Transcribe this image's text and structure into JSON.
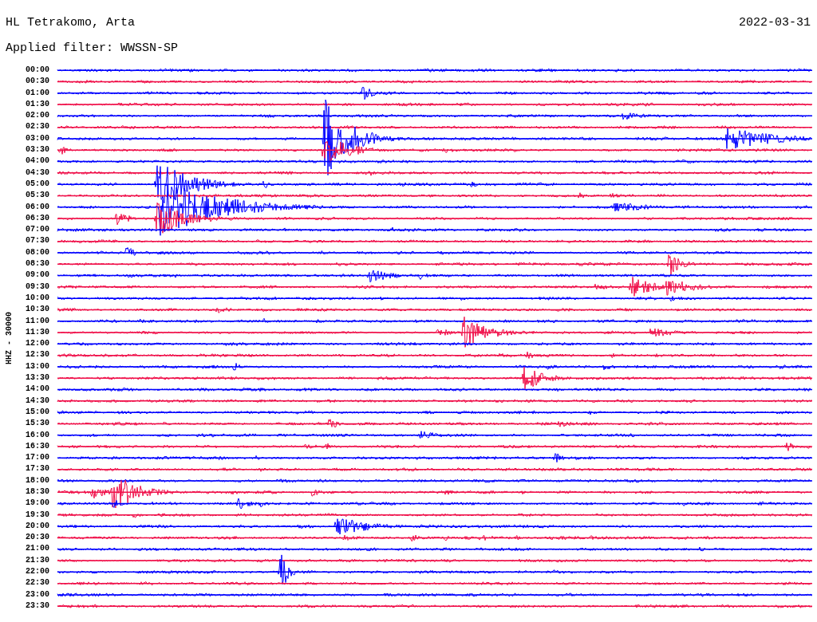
{
  "header": {
    "station": "HL Tetrakomo, Arta",
    "date": "2022-03-31",
    "filter": "Applied filter: WWSSN-SP"
  },
  "channel_label": "HHZ - 30000",
  "traces": [
    {
      "label": "00:00",
      "color": "#0000ff"
    },
    {
      "label": "00:30",
      "color": "#f0104a"
    },
    {
      "label": "01:00",
      "color": "#0000ff"
    },
    {
      "label": "01:30",
      "color": "#f0104a"
    },
    {
      "label": "02:00",
      "color": "#0000ff"
    },
    {
      "label": "02:30",
      "color": "#f0104a"
    },
    {
      "label": "03:00",
      "color": "#0000ff"
    },
    {
      "label": "03:30",
      "color": "#f0104a"
    },
    {
      "label": "04:00",
      "color": "#0000ff"
    },
    {
      "label": "04:30",
      "color": "#f0104a"
    },
    {
      "label": "05:00",
      "color": "#0000ff"
    },
    {
      "label": "05:30",
      "color": "#f0104a"
    },
    {
      "label": "06:00",
      "color": "#0000ff"
    },
    {
      "label": "06:30",
      "color": "#f0104a"
    },
    {
      "label": "07:00",
      "color": "#0000ff"
    },
    {
      "label": "07:30",
      "color": "#f0104a"
    },
    {
      "label": "08:00",
      "color": "#0000ff"
    },
    {
      "label": "08:30",
      "color": "#f0104a"
    },
    {
      "label": "09:00",
      "color": "#0000ff"
    },
    {
      "label": "09:30",
      "color": "#f0104a"
    },
    {
      "label": "10:00",
      "color": "#0000ff"
    },
    {
      "label": "10:30",
      "color": "#f0104a"
    },
    {
      "label": "11:00",
      "color": "#0000ff"
    },
    {
      "label": "11:30",
      "color": "#f0104a"
    },
    {
      "label": "12:00",
      "color": "#0000ff"
    },
    {
      "label": "12:30",
      "color": "#f0104a"
    },
    {
      "label": "13:00",
      "color": "#0000ff"
    },
    {
      "label": "13:30",
      "color": "#f0104a"
    },
    {
      "label": "14:00",
      "color": "#0000ff"
    },
    {
      "label": "14:30",
      "color": "#f0104a"
    },
    {
      "label": "15:00",
      "color": "#0000ff"
    },
    {
      "label": "15:30",
      "color": "#f0104a"
    },
    {
      "label": "16:00",
      "color": "#0000ff"
    },
    {
      "label": "16:30",
      "color": "#f0104a"
    },
    {
      "label": "17:00",
      "color": "#0000ff"
    },
    {
      "label": "17:30",
      "color": "#f0104a"
    },
    {
      "label": "18:00",
      "color": "#0000ff"
    },
    {
      "label": "18:30",
      "color": "#f0104a"
    },
    {
      "label": "19:00",
      "color": "#0000ff"
    },
    {
      "label": "19:30",
      "color": "#f0104a"
    },
    {
      "label": "20:00",
      "color": "#0000ff"
    },
    {
      "label": "20:30",
      "color": "#f0104a"
    },
    {
      "label": "21:00",
      "color": "#0000ff"
    },
    {
      "label": "21:30",
      "color": "#f0104a"
    },
    {
      "label": "22:00",
      "color": "#0000ff"
    },
    {
      "label": "22:30",
      "color": "#f0104a"
    },
    {
      "label": "23:00",
      "color": "#0000ff"
    },
    {
      "label": "23:30",
      "color": "#f0104a"
    }
  ]
}
